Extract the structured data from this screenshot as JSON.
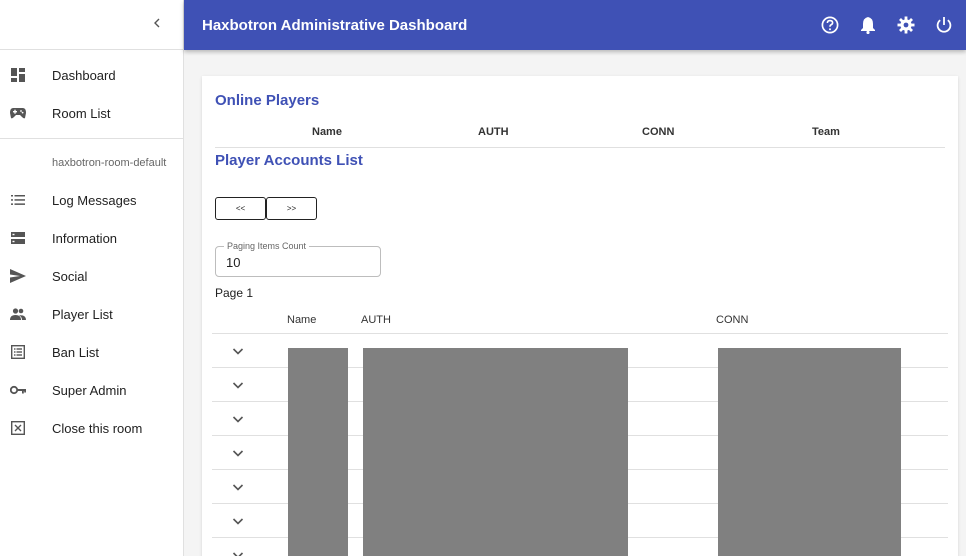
{
  "sidebar": {
    "collapse_icon": "chevron-left-icon",
    "items": [
      {
        "label": "Dashboard",
        "icon": "dashboard-icon"
      },
      {
        "label": "Room List",
        "icon": "gamepad-icon"
      }
    ],
    "room_name": "haxbotron-room-default",
    "room_items": [
      {
        "label": "Log Messages",
        "icon": "list-icon"
      },
      {
        "label": "Information",
        "icon": "storage-icon"
      },
      {
        "label": "Social",
        "icon": "send-icon"
      },
      {
        "label": "Player List",
        "icon": "people-icon"
      },
      {
        "label": "Ban List",
        "icon": "list-alt-icon"
      },
      {
        "label": "Super Admin",
        "icon": "key-icon"
      },
      {
        "label": "Close this room",
        "icon": "close-box-icon"
      }
    ]
  },
  "appbar": {
    "title": "Haxbotron Administrative Dashboard",
    "icons": [
      "help-icon",
      "bell-icon",
      "gear-icon",
      "power-icon"
    ]
  },
  "online_players": {
    "title": "Online Players",
    "columns": [
      "Name",
      "AUTH",
      "CONN",
      "Team"
    ]
  },
  "accounts": {
    "title": "Player Accounts List",
    "prev_label": "<<",
    "next_label": ">>",
    "paging_label": "Paging Items Count",
    "paging_value": "10",
    "page_label": "Page 1",
    "columns": [
      "Name",
      "AUTH",
      "CONN"
    ],
    "row_count": 7
  },
  "colors": {
    "primary": "#3f51b5",
    "redaction": "#808080"
  }
}
